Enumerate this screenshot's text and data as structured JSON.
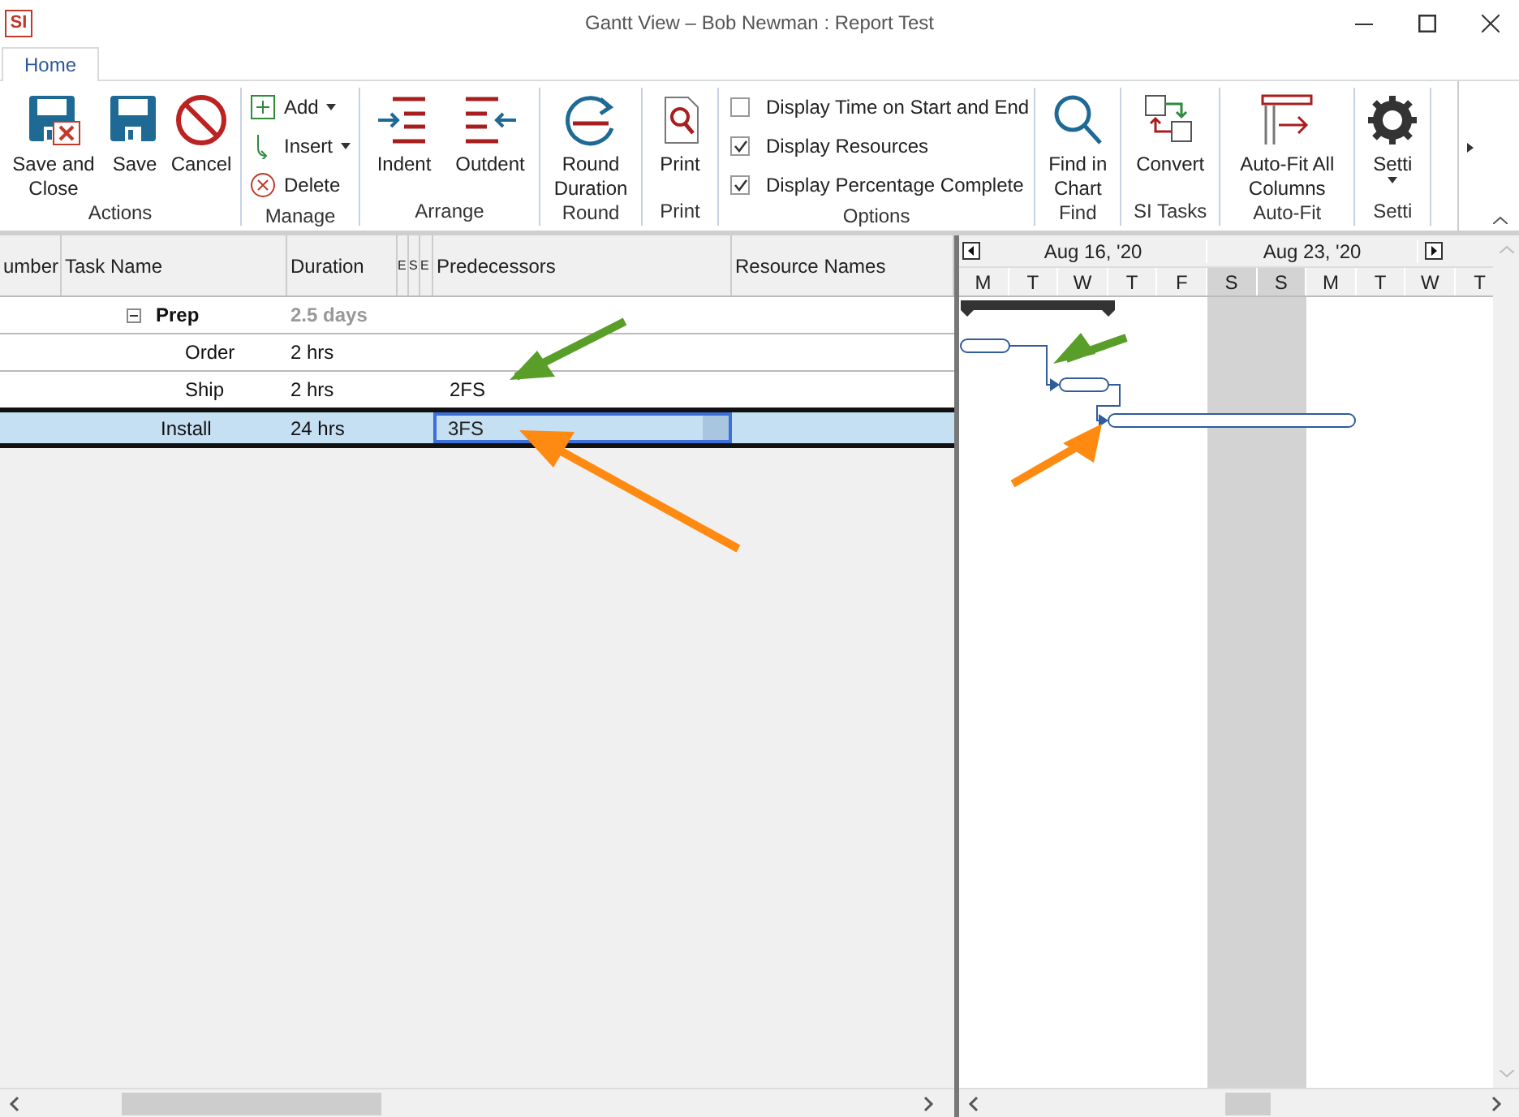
{
  "window": {
    "logo_text": "SI",
    "title": "Gantt View – Bob Newman : Report Test"
  },
  "ribbon_tabs": [
    {
      "label": "Home",
      "selected": true
    }
  ],
  "ribbon_groups": [
    {
      "label": "Actions",
      "items": [
        {
          "kind": "large",
          "label": "Save and Close"
        },
        {
          "kind": "large",
          "label": "Save"
        },
        {
          "kind": "large",
          "label": "Cancel"
        }
      ]
    },
    {
      "label": "Manage",
      "items": [
        {
          "kind": "small",
          "label": "Add",
          "has_menu": true
        },
        {
          "kind": "small",
          "label": "Insert",
          "has_menu": true
        },
        {
          "kind": "small",
          "label": "Delete",
          "has_menu": false
        }
      ]
    },
    {
      "label": "Arrange",
      "items": [
        {
          "kind": "large",
          "label": "Indent"
        },
        {
          "kind": "large",
          "label": "Outdent"
        }
      ]
    },
    {
      "label": "Round",
      "items": [
        {
          "kind": "large",
          "label": "Round Duration"
        }
      ]
    },
    {
      "label": "Print",
      "items": [
        {
          "kind": "large",
          "label": "Print"
        }
      ]
    },
    {
      "label": "Options",
      "items": [
        {
          "kind": "checkbox",
          "label": "Display Time on Start and End",
          "checked": false
        },
        {
          "kind": "checkbox",
          "label": "Display Resources",
          "checked": true
        },
        {
          "kind": "checkbox",
          "label": "Display Percentage Complete",
          "checked": true
        }
      ]
    },
    {
      "label": "Find",
      "items": [
        {
          "kind": "large",
          "label": "Find in Chart"
        }
      ]
    },
    {
      "label": "SI Tasks",
      "items": [
        {
          "kind": "large",
          "label": "Convert"
        }
      ]
    },
    {
      "label": "Auto-Fit",
      "items": [
        {
          "kind": "large",
          "label": "Auto-Fit All Columns"
        }
      ]
    },
    {
      "label": "Setti",
      "items": [
        {
          "kind": "large",
          "label": "Setti",
          "has_menu": true
        }
      ]
    }
  ],
  "table": {
    "columns": [
      "umber",
      "Task Name",
      "Duration",
      "E",
      "S",
      "E",
      "Predecessors",
      "Resource Names"
    ],
    "rows": [
      {
        "kind": "summary",
        "name": "Prep",
        "duration": "2.5 days",
        "expanded": true,
        "selected": false,
        "children": [
          {
            "kind": "task",
            "name": "Order",
            "duration": "2 hrs",
            "selected": false
          },
          {
            "kind": "task",
            "name": "Ship",
            "duration": "2 hrs",
            "predecessors": "2FS",
            "selected": false
          }
        ]
      },
      {
        "kind": "task",
        "name": "Install",
        "duration": "24 hrs",
        "predecessors": "3FS",
        "selected": true
      }
    ]
  },
  "chart": {
    "weeks": [
      "Aug 16, '20",
      "Aug 23, '20"
    ],
    "days": [
      {
        "label": "M",
        "weekend": false
      },
      {
        "label": "T",
        "weekend": false
      },
      {
        "label": "W",
        "weekend": false
      },
      {
        "label": "T",
        "weekend": false
      },
      {
        "label": "F",
        "weekend": false
      },
      {
        "label": "S",
        "weekend": true
      },
      {
        "label": "S",
        "weekend": true
      },
      {
        "label": "M",
        "weekend": false
      },
      {
        "label": "T",
        "weekend": false
      },
      {
        "label": "W",
        "weekend": false
      },
      {
        "label": "T",
        "weekend": false
      }
    ]
  }
}
